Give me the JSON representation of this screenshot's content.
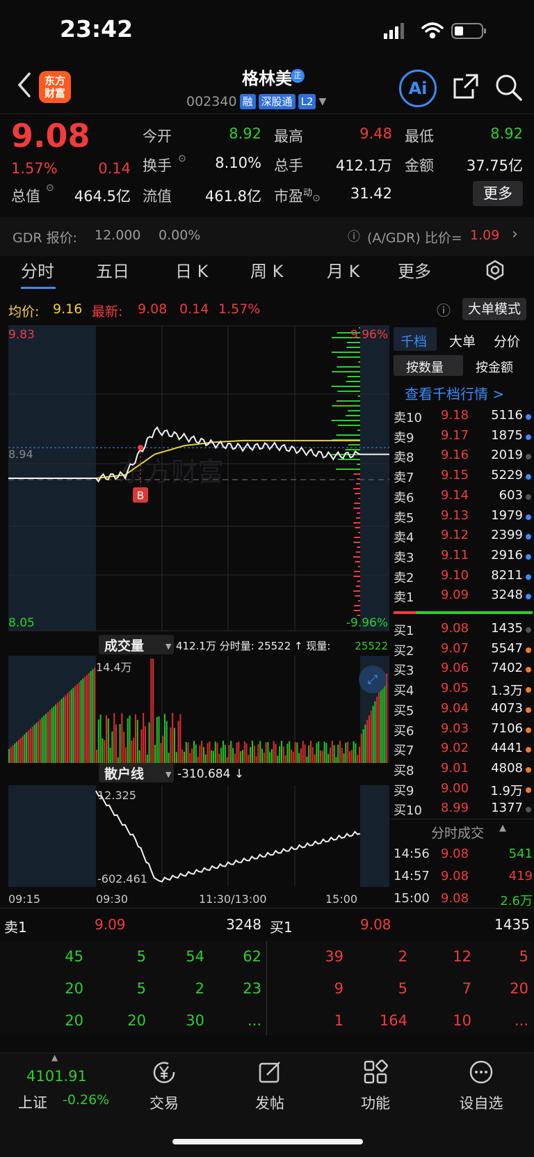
{
  "status_bar": {
    "time": "23:42"
  },
  "header": {
    "logo_text_1": "东方",
    "logo_text_2": "财富",
    "stock_name": "格林美",
    "name_badge": "正",
    "code": "002340",
    "tags": [
      "融",
      "深股通",
      "L2"
    ],
    "ai_label": "Ai"
  },
  "quote": {
    "price": "9.08",
    "change_pct": "1.57%",
    "change": "0.14",
    "open_label": "今开",
    "open": "8.92",
    "high_label": "最高",
    "high": "9.48",
    "low_label": "最低",
    "low": "8.92",
    "turnover_label": "换手",
    "turnover": "8.10%",
    "volume_label": "总手",
    "volume": "412.1万",
    "amount_label": "金额",
    "amount": "37.75亿",
    "mktcap_label": "总值",
    "mktcap": "464.5亿",
    "float_label": "流值",
    "float": "461.8亿",
    "pe_label": "市盈",
    "pe_sup": "动",
    "pe": "31.42",
    "more_label": "更多"
  },
  "gdr": {
    "label": "GDR 报价:",
    "price": "12.000",
    "pct": "0.00%",
    "ratio_label": "(A/GDR) 比价=",
    "ratio": "1.09"
  },
  "tabs": [
    "分时",
    "五日",
    "日 K",
    "周 K",
    "月 K",
    "更多"
  ],
  "info_bar": {
    "avg_label": "均价:",
    "avg": "9.16",
    "latest_label": "最新:",
    "latest": "9.08",
    "change": "0.14",
    "pct": "1.57%",
    "mode_button": "大单模式"
  },
  "chart": {
    "price_max": "9.83",
    "price_min": "8.05",
    "pct_max": "9.96%",
    "pct_min": "-9.96%",
    "prev_close": "8.94",
    "watermark": "东方财富",
    "marker": "B",
    "volume_panel": {
      "selector": "成交量",
      "summary": "412.1万 分时量: 25522 ↑ 现量:",
      "current": "25522",
      "max_label": "14.4万"
    },
    "retail_panel": {
      "selector": "散户线",
      "value": "-310.684 ↓",
      "max_label": "12.325",
      "min_label": "-602.461"
    },
    "time_labels": [
      "09:15",
      "09:30",
      "11:30/13:00",
      "15:00"
    ]
  },
  "chart_data": {
    "type": "line",
    "title": "",
    "xlabel": "",
    "ylabel": "",
    "ylim": [
      8.05,
      9.83
    ],
    "prev_close": 8.94,
    "x": [
      "09:15",
      "09:30",
      "10:00",
      "10:30",
      "11:00",
      "11:30/13:00",
      "13:30",
      "14:00",
      "14:30",
      "15:00"
    ],
    "series": [
      {
        "values": [
          8.94,
          8.96,
          9.22,
          9.18,
          9.14,
          9.12,
          9.13,
          9.1,
          9.07,
          9.08
        ]
      },
      {
        "values": [
          8.94,
          8.96,
          9.08,
          9.13,
          9.15,
          9.16,
          9.16,
          9.16,
          9.16,
          9.16
        ]
      }
    ]
  },
  "order_book": {
    "tabs": [
      "千档",
      "大单",
      "分价"
    ],
    "sub_tabs": [
      "按数量",
      "按金额"
    ],
    "link": "查看千档行情 >",
    "asks": [
      {
        "label": "卖10",
        "price": "9.18",
        "vol": "5116",
        "dot": "#3b8cf5"
      },
      {
        "label": "卖9",
        "price": "9.17",
        "vol": "1875",
        "dot": "#3b8cf5"
      },
      {
        "label": "卖8",
        "price": "9.16",
        "vol": "2019",
        "dot": "#555555"
      },
      {
        "label": "卖7",
        "price": "9.15",
        "vol": "5229",
        "dot": "#3b8cf5"
      },
      {
        "label": "卖6",
        "price": "9.14",
        "vol": "603",
        "dot": "#555555"
      },
      {
        "label": "卖5",
        "price": "9.13",
        "vol": "1979",
        "dot": "#3b8cf5"
      },
      {
        "label": "卖4",
        "price": "9.12",
        "vol": "2399",
        "dot": "#3b8cf5"
      },
      {
        "label": "卖3",
        "price": "9.11",
        "vol": "2916",
        "dot": "#3b8cf5"
      },
      {
        "label": "卖2",
        "price": "9.10",
        "vol": "8211",
        "dot": "#3b8cf5"
      },
      {
        "label": "卖1",
        "price": "9.09",
        "vol": "3248",
        "dot": "#3b8cf5"
      }
    ],
    "bids": [
      {
        "label": "买1",
        "price": "9.08",
        "vol": "1435",
        "dot": "#555555"
      },
      {
        "label": "买2",
        "price": "9.07",
        "vol": "5547",
        "dot": "#f07a2a"
      },
      {
        "label": "买3",
        "price": "9.06",
        "vol": "7402",
        "dot": "#f07a2a"
      },
      {
        "label": "买4",
        "price": "9.05",
        "vol": "1.3万",
        "dot": "#f07a2a"
      },
      {
        "label": "买5",
        "price": "9.04",
        "vol": "4073",
        "dot": "#f07a2a"
      },
      {
        "label": "买6",
        "price": "9.03",
        "vol": "7106",
        "dot": "#f07a2a"
      },
      {
        "label": "买7",
        "price": "9.02",
        "vol": "4441",
        "dot": "#f07a2a"
      },
      {
        "label": "买8",
        "price": "9.01",
        "vol": "4808",
        "dot": "#f07a2a"
      },
      {
        "label": "买9",
        "price": "9.00",
        "vol": "1.9万",
        "dot": "#f07a2a"
      },
      {
        "label": "买10",
        "price": "8.99",
        "vol": "1377",
        "dot": "#555555"
      }
    ],
    "trades_title": "分时成交",
    "trades": [
      {
        "time": "14:56",
        "price": "9.08",
        "vol": "541",
        "color": "#2bd02b"
      },
      {
        "time": "14:57",
        "price": "9.08",
        "vol": "419",
        "color": "#f23b3b"
      },
      {
        "time": "15:00",
        "price": "9.08",
        "vol": "2.6万",
        "color": "#2bd02b"
      }
    ]
  },
  "queue": {
    "sell_label": "卖1",
    "sell_price": "9.09",
    "sell_total": "3248",
    "buy_label": "买1",
    "buy_price": "9.08",
    "buy_total": "1435",
    "sell_rows": [
      [
        "45",
        "5",
        "54",
        "62"
      ],
      [
        "20",
        "5",
        "2",
        "23"
      ],
      [
        "20",
        "20",
        "30",
        "..."
      ]
    ],
    "buy_rows": [
      [
        "39",
        "2",
        "12",
        "5"
      ],
      [
        "9",
        "5",
        "7",
        "20"
      ],
      [
        "1",
        "164",
        "10",
        "..."
      ]
    ]
  },
  "bottom_nav": {
    "index_value": "4101.91",
    "index_name": "上证",
    "index_change": "-0.26%",
    "items": [
      "交易",
      "发帖",
      "功能",
      "设自选"
    ]
  }
}
